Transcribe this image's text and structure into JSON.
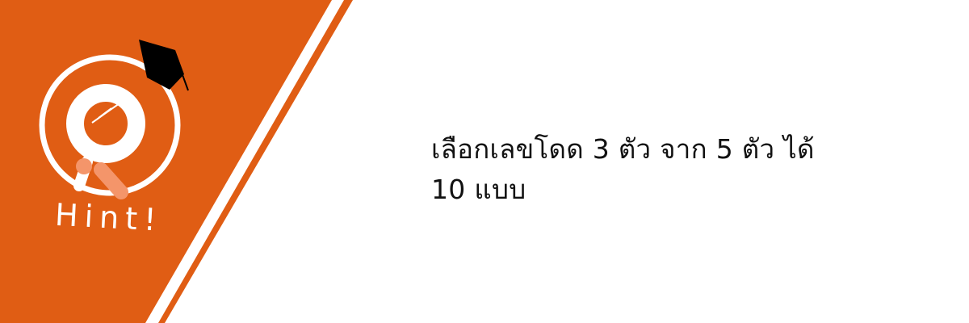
{
  "logo": {
    "label": "Hint!"
  },
  "hint": {
    "line1": "เลือกเลขโดด 3 ตัว จาก 5 ตัว ได้",
    "line2": "10 แบบ"
  },
  "colors": {
    "brand": "#E05D14",
    "accent_light": "#F4956A",
    "text": "#111111"
  }
}
